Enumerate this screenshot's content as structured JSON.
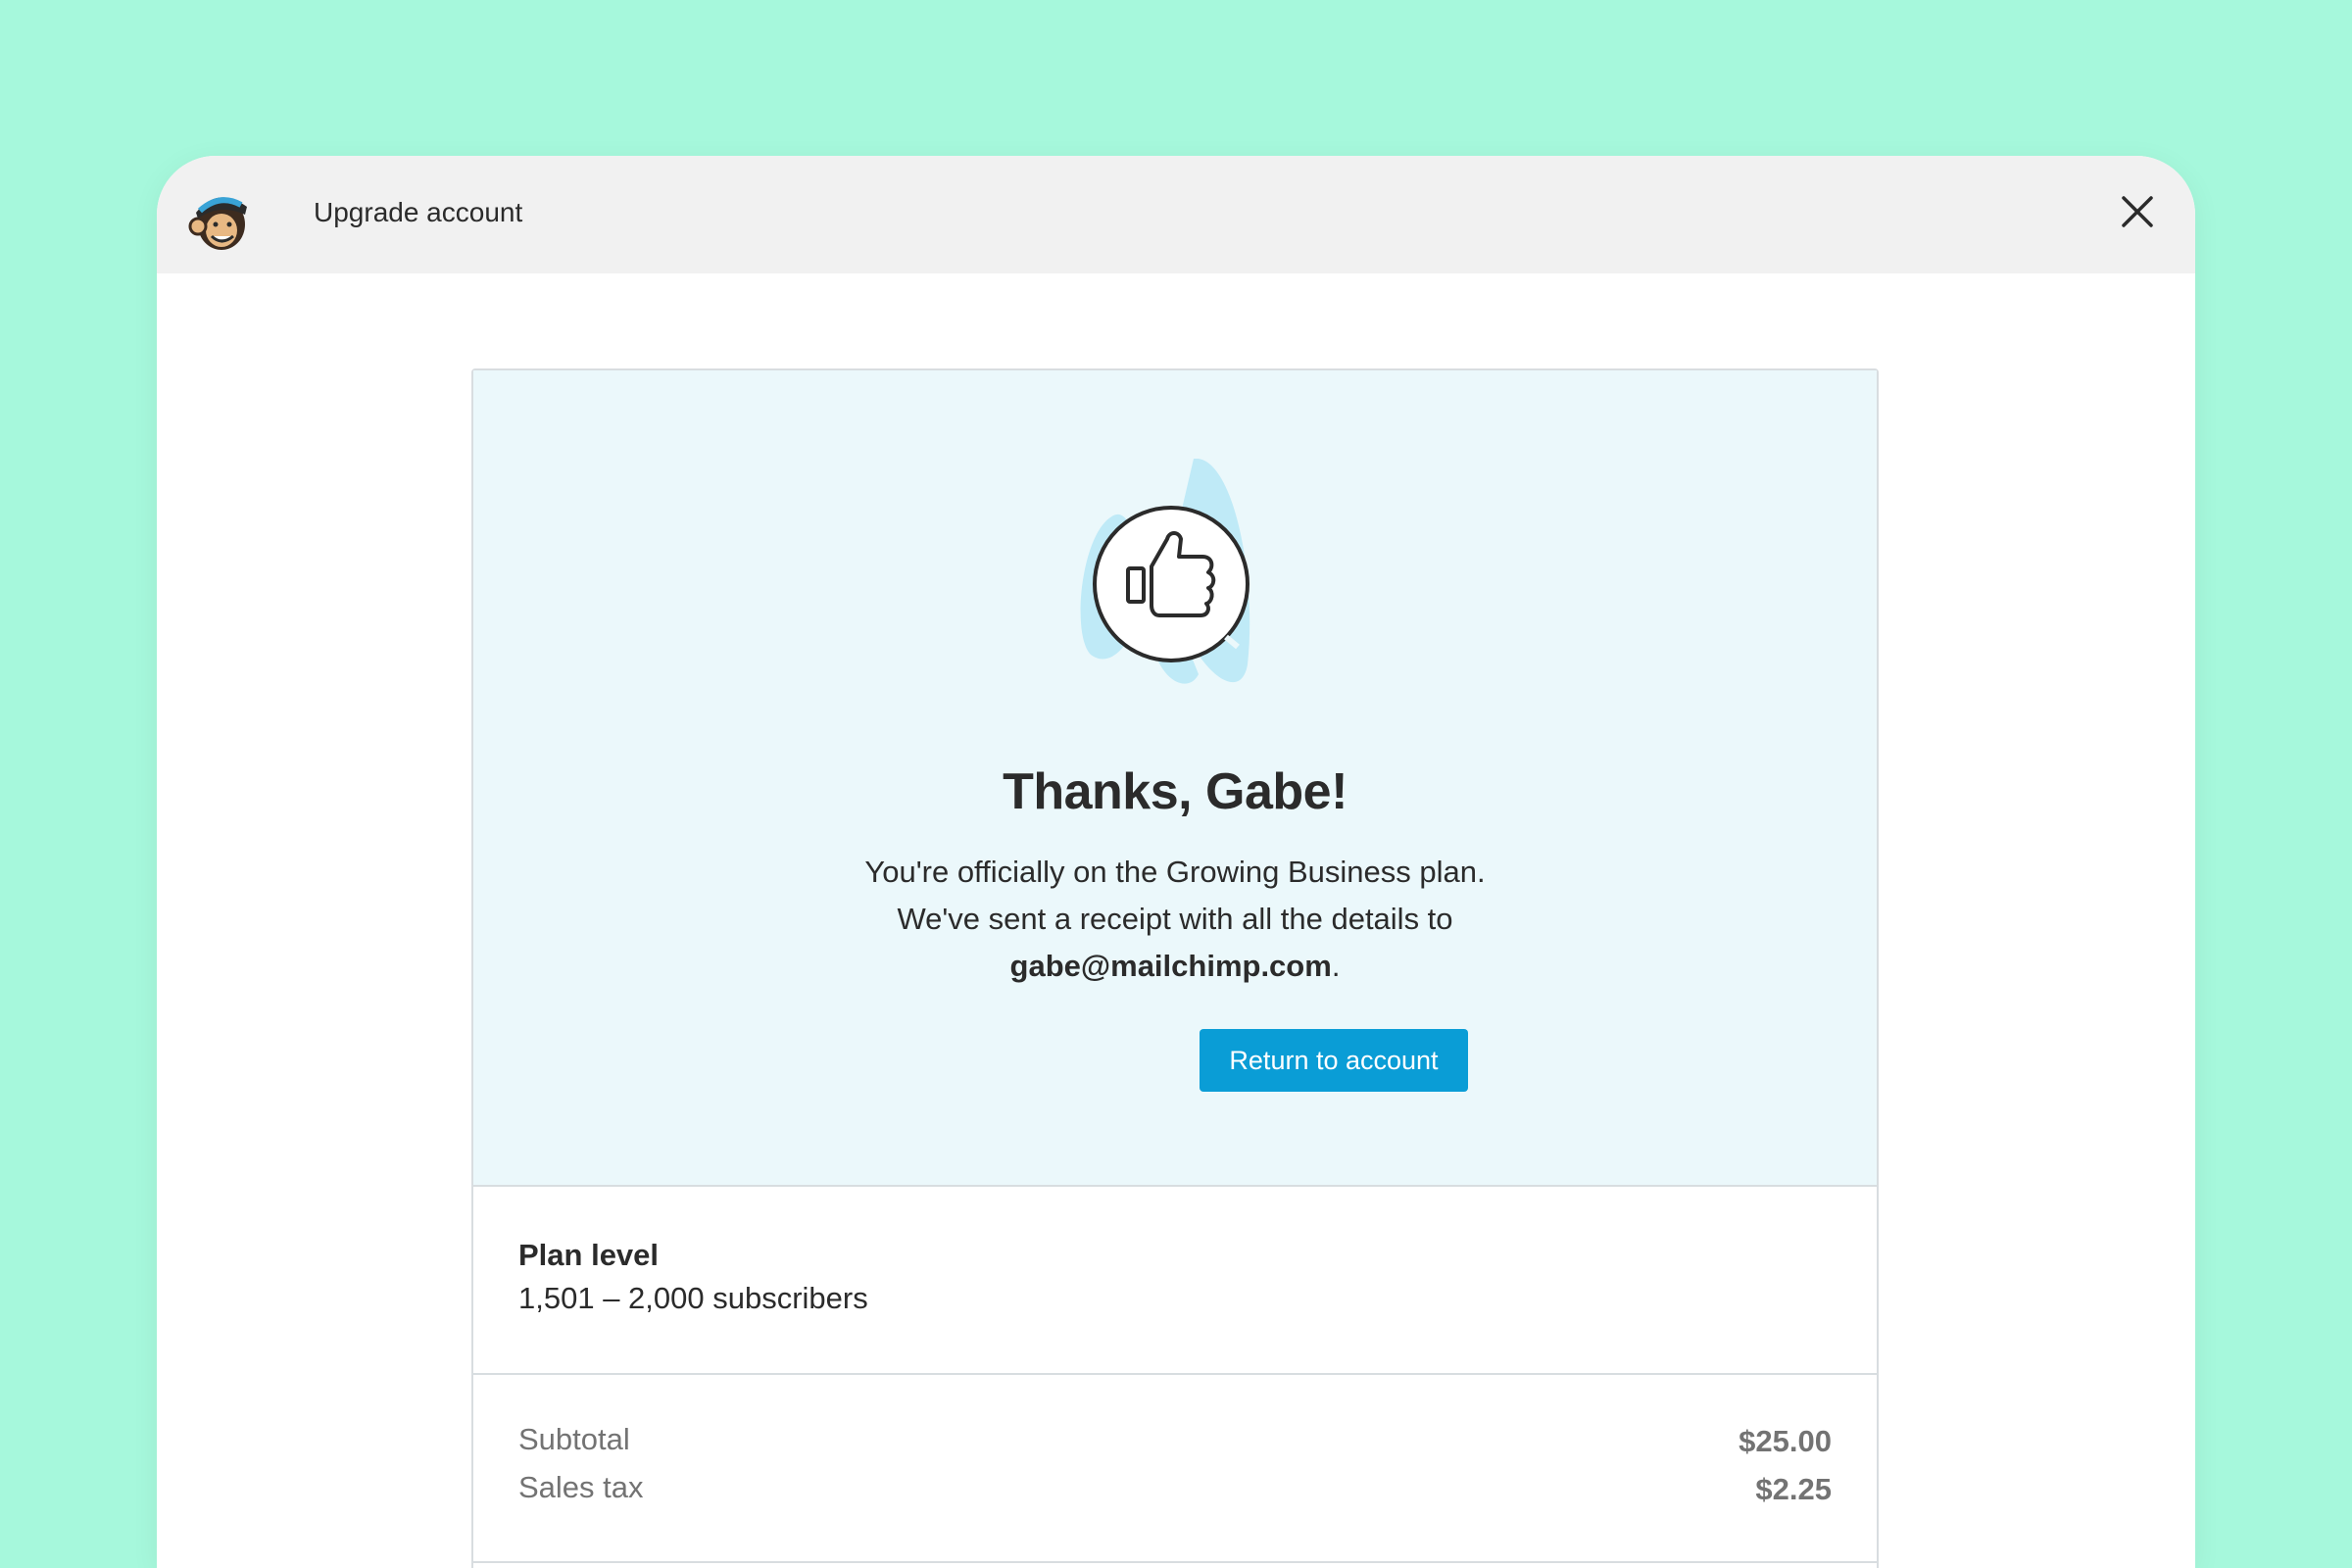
{
  "colors": {
    "page_background": "#a6f8dc",
    "topbar_background": "#f1f1f1",
    "hero_background": "#ebf8fb",
    "button_background": "#0a9dd6",
    "accent_blob": "#bfeaf7",
    "text_dark": "#2b2b2b",
    "text_muted": "#737373"
  },
  "topbar": {
    "logo_icon": "mailchimp-freddie-logo",
    "title": "Upgrade account",
    "close_icon": "close-x"
  },
  "hero": {
    "icon": "thumbs-up",
    "title": "Thanks, Gabe!",
    "line1": "You're officially on the Growing Business plan.",
    "line2": "We've sent a receipt with all the details to",
    "email": "gabe@mailchimp.com",
    "email_suffix": ".",
    "button_label": "Return to account"
  },
  "plan": {
    "label": "Plan level",
    "value": "1,501 – 2,000 subscribers"
  },
  "totals": [
    {
      "label": "Subtotal",
      "amount": "$25.00"
    },
    {
      "label": "Sales tax",
      "amount": "$2.25"
    }
  ]
}
